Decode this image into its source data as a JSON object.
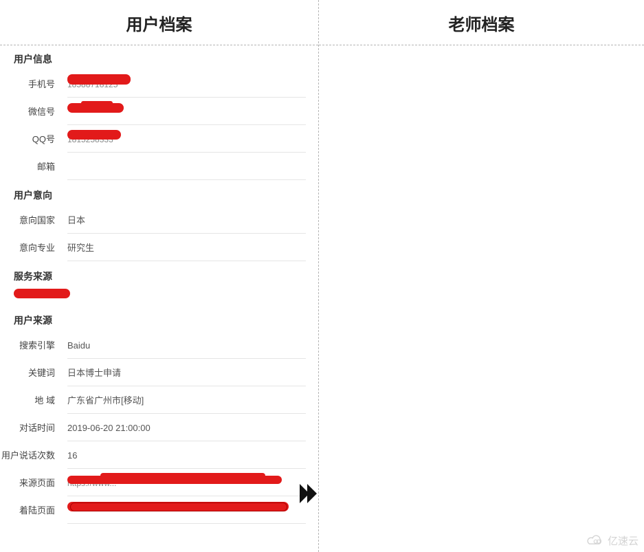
{
  "left": {
    "title": "用户档案",
    "sections": {
      "user_info": {
        "title": "用户信息",
        "phone_label": "手机号",
        "phone_value": "18588718125",
        "wechat_label": "微信号",
        "wechat_value": "",
        "qq_label": "QQ号",
        "qq_value": "1815258333",
        "email_label": "邮箱",
        "email_value": ""
      },
      "intent": {
        "title": "用户意向",
        "country_label": "意向国家",
        "country_value": "日本",
        "major_label": "意向专业",
        "major_value": "研究生"
      },
      "service": {
        "title": "服务来源",
        "value": ""
      },
      "source": {
        "title": "用户来源",
        "engine_label": "搜索引擎",
        "engine_value": "Baidu",
        "keyword_label": "关键词",
        "keyword_value": "日本博士申请",
        "region_label": "地 域",
        "region_value": "广东省广州市[移动]",
        "dialog_time_label": "对话时间",
        "dialog_time_value": "2019-06-20 21:00:00",
        "talk_count_label": "用户说话次数",
        "talk_count_value": "16",
        "referrer_label": "来源页面",
        "referrer_value": "https://www...",
        "landing_label": "着陆页面",
        "landing_value": ""
      }
    }
  },
  "right": {
    "title": "老师档案"
  },
  "watermark": "亿速云"
}
